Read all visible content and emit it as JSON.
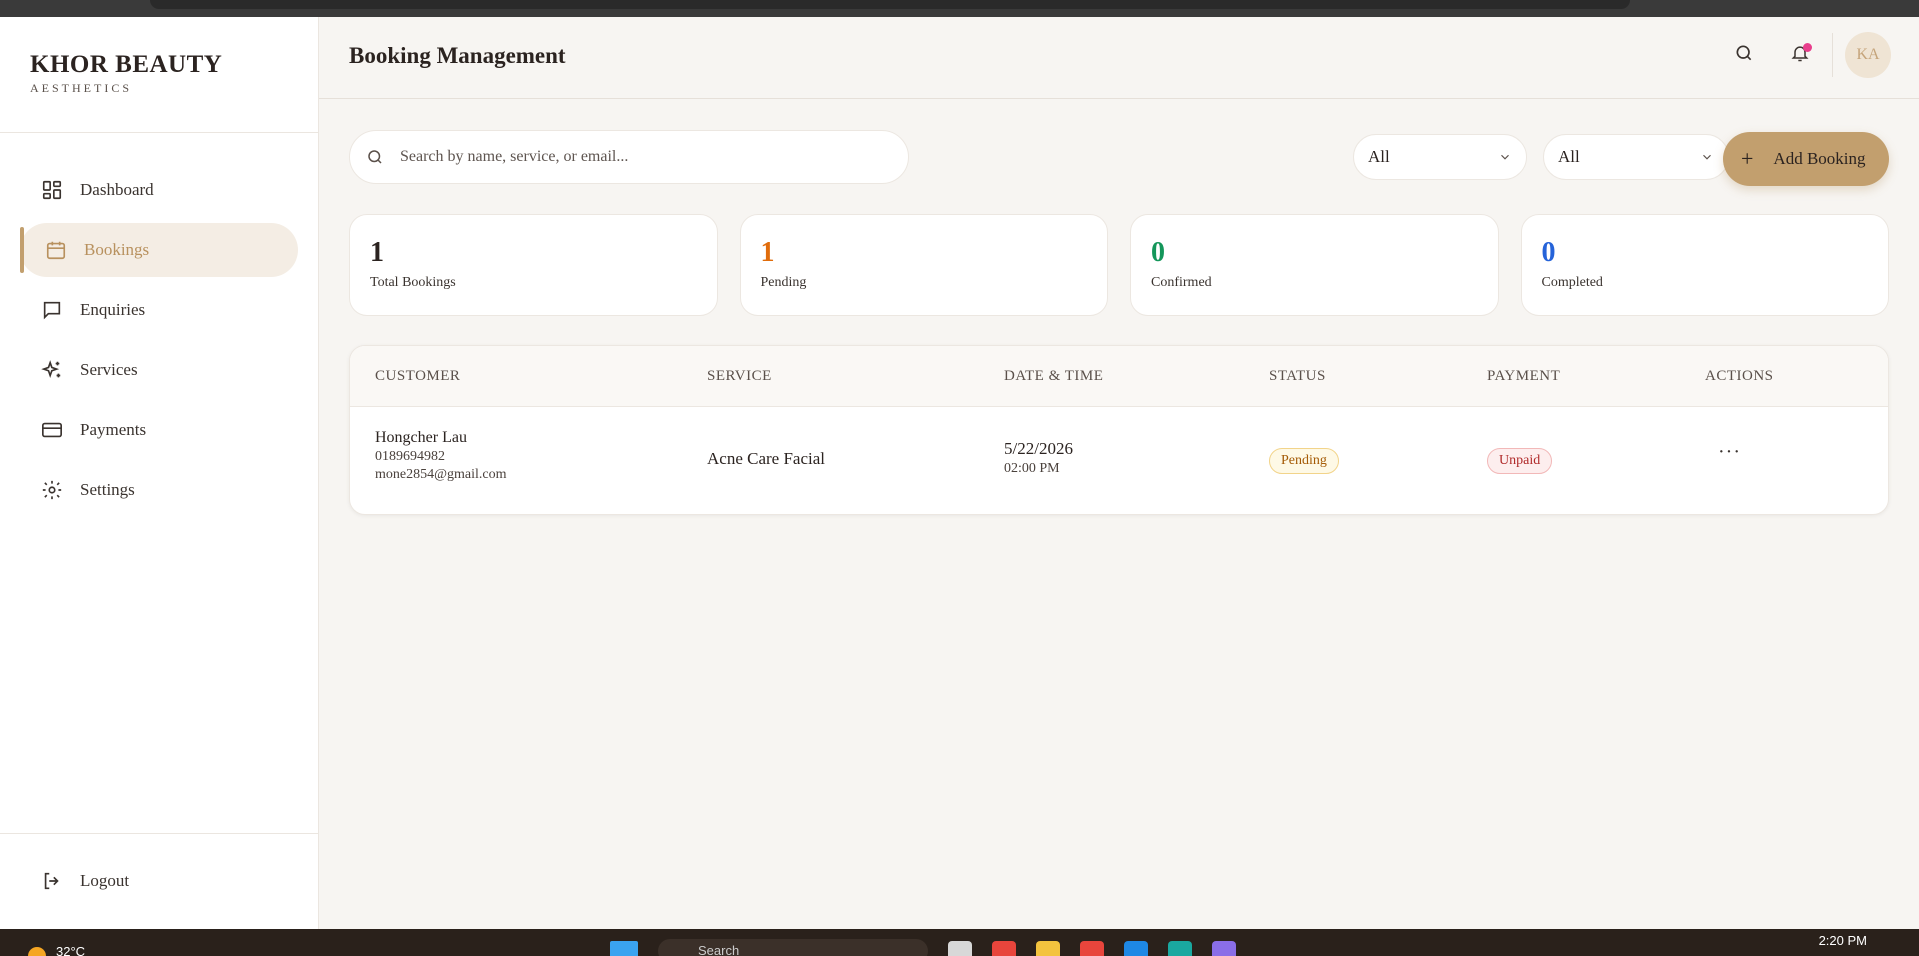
{
  "brand": {
    "name": "KHOR BEAUTY",
    "subtitle": "AESTHETICS"
  },
  "sidebar": {
    "items": [
      {
        "label": "Dashboard",
        "icon": "grid-icon",
        "active": false
      },
      {
        "label": "Bookings",
        "icon": "calendar-icon",
        "active": true
      },
      {
        "label": "Enquiries",
        "icon": "message-icon",
        "active": false
      },
      {
        "label": "Services",
        "icon": "sparkles-icon",
        "active": false
      },
      {
        "label": "Payments",
        "icon": "credit-card-icon",
        "active": false
      },
      {
        "label": "Settings",
        "icon": "gear-icon",
        "active": false
      }
    ],
    "logout_label": "Logout"
  },
  "header": {
    "title": "Booking Management",
    "avatar_initials": "KA"
  },
  "toolbar": {
    "search_placeholder": "Search by name, service, or email...",
    "status_filter": "All",
    "payment_filter": "All",
    "add_label": "Add Booking"
  },
  "stats": [
    {
      "value": "1",
      "label": "Total Bookings",
      "color": "#2b2320"
    },
    {
      "value": "1",
      "label": "Pending",
      "color": "#e06c0b"
    },
    {
      "value": "0",
      "label": "Confirmed",
      "color": "#14965a"
    },
    {
      "value": "0",
      "label": "Completed",
      "color": "#2563d9"
    }
  ],
  "table": {
    "headers": [
      "CUSTOMER",
      "SERVICE",
      "DATE & TIME",
      "STATUS",
      "PAYMENT",
      "ACTIONS"
    ],
    "rows": [
      {
        "name": "Hongcher Lau",
        "phone": "0189694982",
        "email": "mone2854@gmail.com",
        "service": "Acne Care Facial",
        "date": "5/22/2026",
        "time": "02:00 PM",
        "status": "Pending",
        "payment": "Unpaid",
        "actions": "···"
      }
    ]
  },
  "taskbar": {
    "temperature": "32°C",
    "search_text": "Search",
    "time": "2:20 PM"
  },
  "colors": {
    "accent": "#c29f6e",
    "pending": "#e06c0b",
    "confirmed": "#14965a",
    "completed": "#2563d9",
    "notification": "#e83e8c"
  }
}
